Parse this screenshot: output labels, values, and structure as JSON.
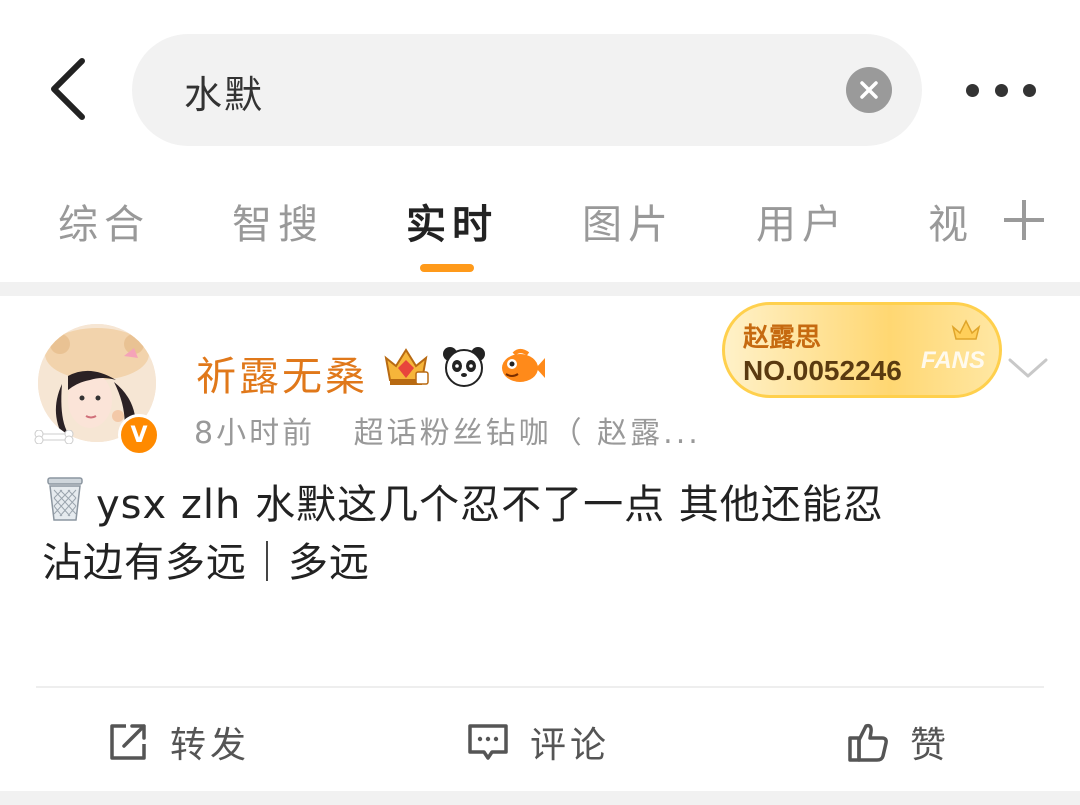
{
  "search": {
    "query": "水默"
  },
  "tabs": [
    {
      "label": "综合"
    },
    {
      "label": "智搜"
    },
    {
      "label": "实时"
    },
    {
      "label": "图片"
    },
    {
      "label": "用户"
    },
    {
      "label": "视"
    }
  ],
  "active_tab": "实时",
  "post": {
    "username": "祈露无桑",
    "time": "8小时前",
    "source": "超话粉丝钻咖（ 赵露...",
    "verified_badge": "V",
    "fans_card": {
      "name": "赵露思",
      "number": "NO.0052246",
      "label": "FANS"
    },
    "text_line1": "ysx zlh 水默这几个忍不了一点 其他还能忍",
    "text_line2": "沾边有多远｜多远",
    "actions": {
      "repost": "转发",
      "comment": "评论",
      "like": "赞"
    }
  },
  "colors": {
    "accent": "#ff9a1a",
    "username": "#e0781a",
    "muted": "#999999"
  }
}
